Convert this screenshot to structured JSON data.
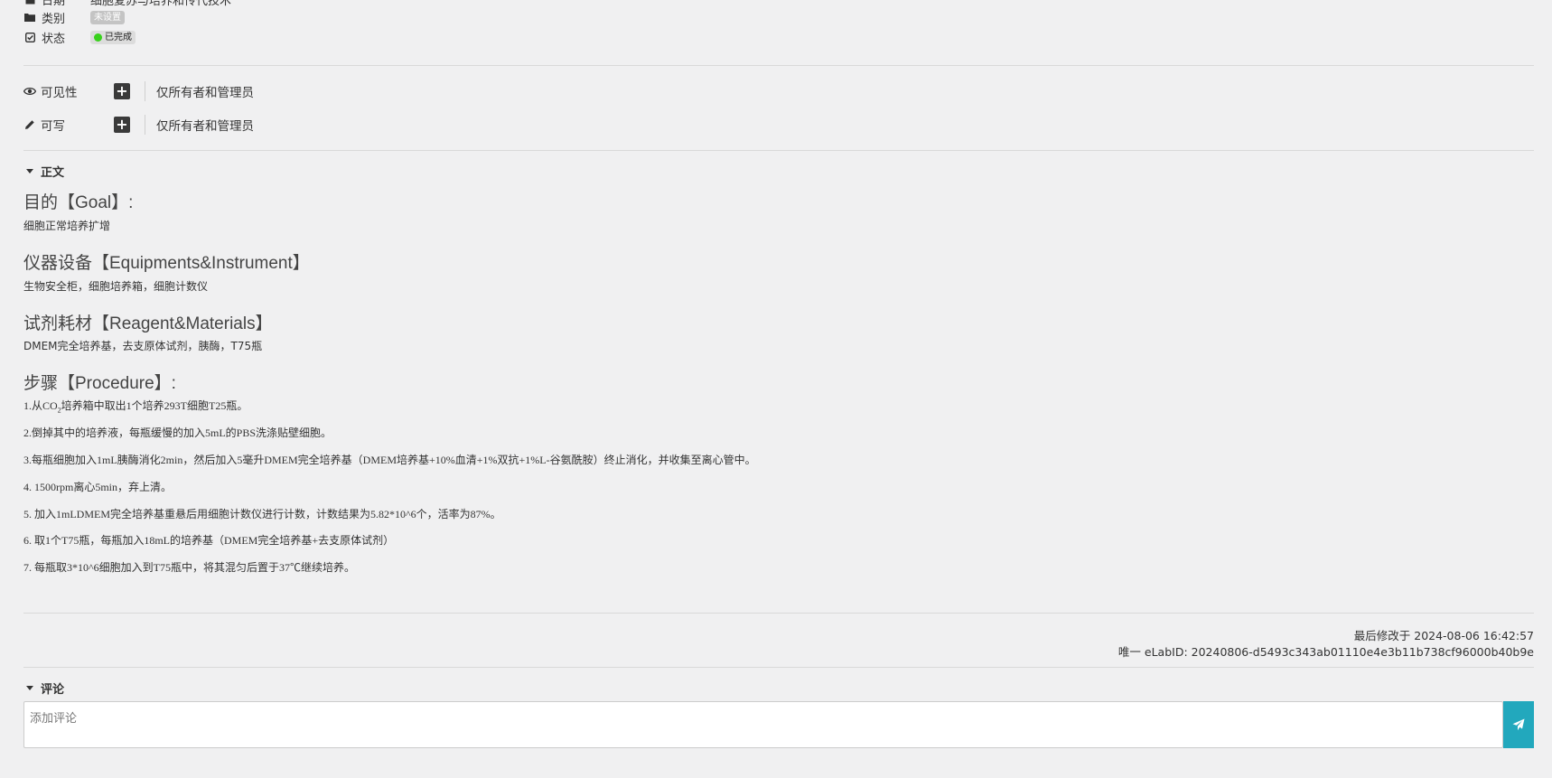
{
  "meta": {
    "title_row_label": "日期",
    "title_row_value": "细胞复苏与培养和传代技术",
    "category_label": "类别",
    "category_value": "未设置",
    "status_label": "状态",
    "status_value": "已完成",
    "status_color": "#38d11c"
  },
  "permissions": {
    "visibility_label": "可见性",
    "visibility_value": "仅所有者和管理员",
    "write_label": "可写",
    "write_value": "仅所有者和管理员"
  },
  "body_section": {
    "toggle_label": "正文",
    "goal_heading": "目的【Goal】:",
    "goal_text": "细胞正常培养扩增",
    "equip_heading": "仪器设备【Equipments&Instrument】",
    "equip_text": "生物安全柜，细胞培养箱，细胞计数仪",
    "reagent_heading": "试剂耗材【Reagent&Materials】",
    "reagent_text": "DMEM完全培养基，去支原体试剂，胰酶，T75瓶",
    "procedure_heading": "步骤【Procedure】:",
    "steps": {
      "s1_pre": "1.从CO",
      "s1_sub": "2",
      "s1_post": "培养箱中取出1个培养293T细胞T25瓶。",
      "s2": "2.倒掉其中的培养液，每瓶缓慢的加入5mL的PBS洗涤贴壁细胞。",
      "s3": "3.每瓶细胞加入1mL胰酶消化2min，然后加入5毫升DMEM完全培养基（DMEM培养基+10%血清+1%双抗+1%L-谷氨酰胺）终止消化，并收集至离心管中。",
      "s4": "4. 1500rpm离心5min，弃上清。",
      "s5": "5. 加入1mLDMEM完全培养基重悬后用细胞计数仪进行计数，计数结果为5.82*10^6个，活率为87%。",
      "s6": "6. 取1个T75瓶，每瓶加入18mL的培养基（DMEM完全培养基+去支原体试剂）",
      "s7": "7. 每瓶取3*10^6细胞加入到T75瓶中，将其混匀后置于37℃继续培养。"
    }
  },
  "footer": {
    "last_modified": "最后修改于 2024-08-06 16:42:57",
    "elabid": "唯一 eLabID:  20240806-d5493c343ab01110e4e3b11b738cf96000b40b9e"
  },
  "comments": {
    "toggle_label": "评论",
    "placeholder": "添加评论",
    "send_color": "#22a8bd"
  }
}
